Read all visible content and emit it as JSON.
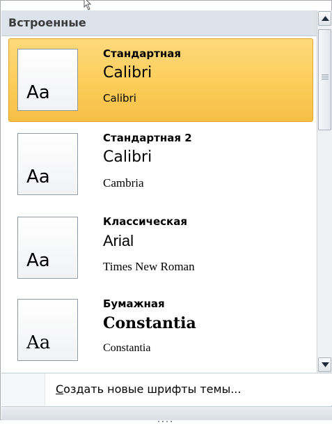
{
  "section_header": {
    "label": "Встроенные"
  },
  "theme_fonts": [
    {
      "preview": "Aa",
      "name": "Стандартная",
      "heading_font": "Calibri",
      "body_font": "Calibri",
      "selected": true
    },
    {
      "preview": "Aa",
      "name": "Стандартная 2",
      "heading_font": "Calibri",
      "body_font": "Cambria",
      "selected": false
    },
    {
      "preview": "Aa",
      "name": "Классическая",
      "heading_font": "Arial",
      "body_font": "Times New Roman",
      "selected": false
    },
    {
      "preview": "Aa",
      "name": "Бумажная",
      "heading_font": "Constantia",
      "body_font": "Constantia",
      "selected": false
    }
  ],
  "footer": {
    "create_label_first": "С",
    "create_label_rest": "оздать новые шрифты темы..."
  },
  "colors": {
    "selected_fill": "#fbcd5a",
    "selected_border": "#e0a72a",
    "header_bg": "#dde3ea"
  },
  "icons": {
    "scroll_up": "scroll-up-arrow-icon",
    "scroll_down": "scroll-down-arrow-icon",
    "cursor": "mouse-cursor-icon"
  }
}
